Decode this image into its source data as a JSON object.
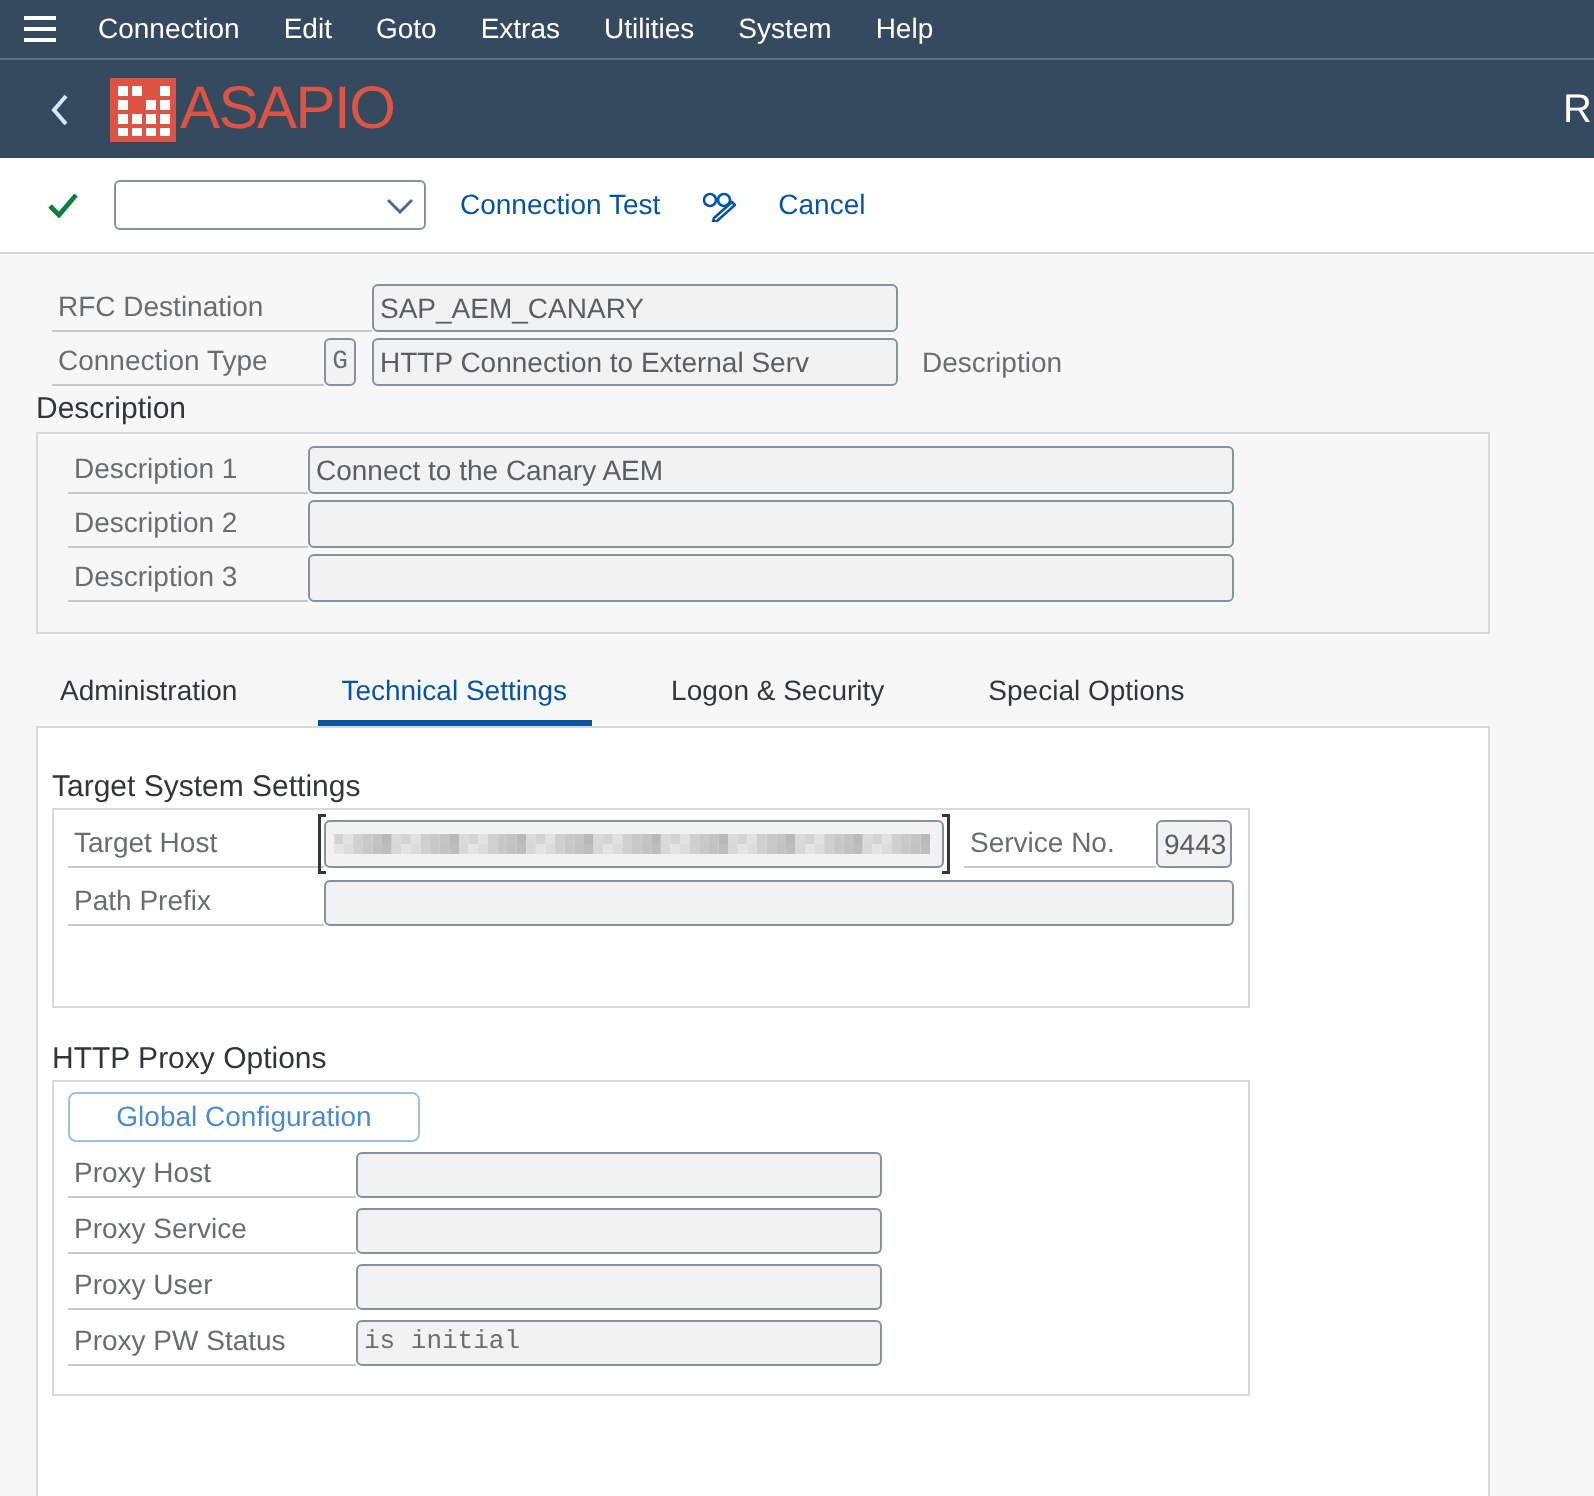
{
  "menu_bar": {
    "items": [
      "Connection",
      "Edit",
      "Goto",
      "Extras",
      "Utilities",
      "System",
      "Help"
    ]
  },
  "title_bar": {
    "logo_text": "ASAPIO",
    "title": "R"
  },
  "toolbar": {
    "links": [
      "Connection Test",
      "Cancel"
    ]
  },
  "header_fields": [
    {
      "label": "RFC Destination",
      "value": "SAP_AEM_CANARY"
    },
    {
      "label": "Connection Type",
      "code": "G",
      "value": "HTTP Connection to External Serv",
      "note": "Description"
    }
  ],
  "description_group": {
    "title": "Description",
    "fields": [
      {
        "label": "Description 1",
        "value": "Connect to the Canary AEM"
      },
      {
        "label": "Description 2"
      },
      {
        "label": "Description 3"
      }
    ]
  },
  "tabs": [
    {
      "label": "Administration",
      "selected": false
    },
    {
      "label": "Technical Settings",
      "selected": true
    },
    {
      "label": "Logon & Security",
      "selected": false
    },
    {
      "label": "Special Options",
      "selected": false
    }
  ],
  "target_system": {
    "title": "Target System Settings",
    "target_host": {
      "label": "Target Host",
      "focused": true
    },
    "service_no": {
      "label": "Service No.",
      "value": "9443"
    },
    "path_prefix": {
      "label": "Path Prefix"
    }
  },
  "proxy": {
    "title": "HTTP Proxy Options",
    "button": "Global Configuration",
    "fields": [
      {
        "label": "Proxy Host"
      },
      {
        "label": "Proxy Service"
      },
      {
        "label": "Proxy User"
      },
      {
        "label": "Proxy PW Status",
        "value": "is initial"
      }
    ]
  }
}
